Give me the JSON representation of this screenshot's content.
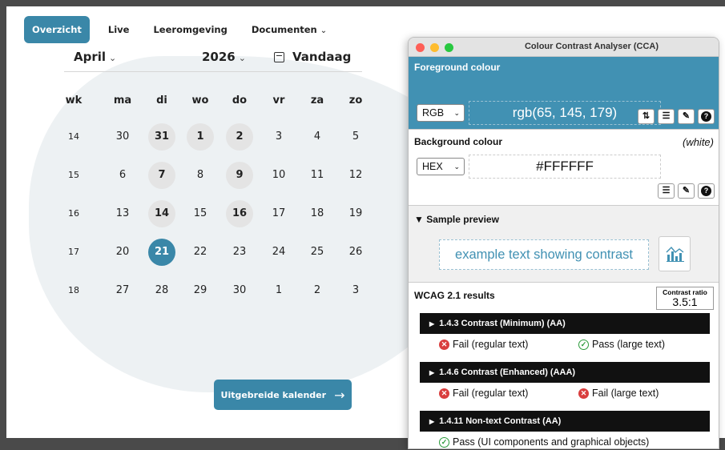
{
  "nav": {
    "items": [
      {
        "label": "Overzicht"
      },
      {
        "label": "Live"
      },
      {
        "label": "Leeromgeving"
      },
      {
        "label": "Documenten"
      }
    ]
  },
  "calendar": {
    "month": "April",
    "year": "2026",
    "today": "Vandaag",
    "headers": [
      "wk",
      "ma",
      "di",
      "wo",
      "do",
      "vr",
      "za",
      "zo"
    ],
    "weeks": [
      {
        "wk": "14",
        "days": [
          "30",
          "31",
          "1",
          "2",
          "3",
          "4",
          "5"
        ]
      },
      {
        "wk": "15",
        "days": [
          "6",
          "7",
          "8",
          "9",
          "10",
          "11",
          "12"
        ]
      },
      {
        "wk": "16",
        "days": [
          "13",
          "14",
          "15",
          "16",
          "17",
          "18",
          "19"
        ]
      },
      {
        "wk": "17",
        "days": [
          "20",
          "21",
          "22",
          "23",
          "24",
          "25",
          "26"
        ]
      },
      {
        "wk": "18",
        "days": [
          "27",
          "28",
          "29",
          "30",
          "1",
          "2",
          "3"
        ]
      }
    ],
    "extended_button": "Uitgebreide kalender",
    "selected_color": "#3a87a8"
  },
  "cca": {
    "title": "Colour Contrast Analyser (CCA)",
    "foreground": {
      "title": "Foreground colour",
      "format": "RGB",
      "value": "rgb(65, 145, 179)",
      "color": "#4191b3"
    },
    "background": {
      "title": "Background colour",
      "note": "(white)",
      "format": "HEX",
      "value": "#FFFFFF"
    },
    "preview": {
      "title": "Sample preview",
      "sample": "example text showing contrast"
    },
    "results": {
      "title": "WCAG 2.1 results",
      "ratio_label": "Contrast ratio",
      "ratio": "3.5:1",
      "criteria": [
        {
          "name": "1.4.3 Contrast (Minimum) (AA)",
          "results": [
            {
              "status": "fail",
              "text": "Fail (regular text)"
            },
            {
              "status": "pass",
              "text": "Pass (large text)"
            }
          ]
        },
        {
          "name": "1.4.6 Contrast (Enhanced) (AAA)",
          "results": [
            {
              "status": "fail",
              "text": "Fail (regular text)"
            },
            {
              "status": "fail",
              "text": "Fail (large text)"
            }
          ]
        },
        {
          "name": "1.4.11 Non-text Contrast (AA)",
          "results": [
            {
              "status": "pass",
              "text": "Pass (UI components and graphical objects)"
            }
          ]
        }
      ]
    }
  }
}
